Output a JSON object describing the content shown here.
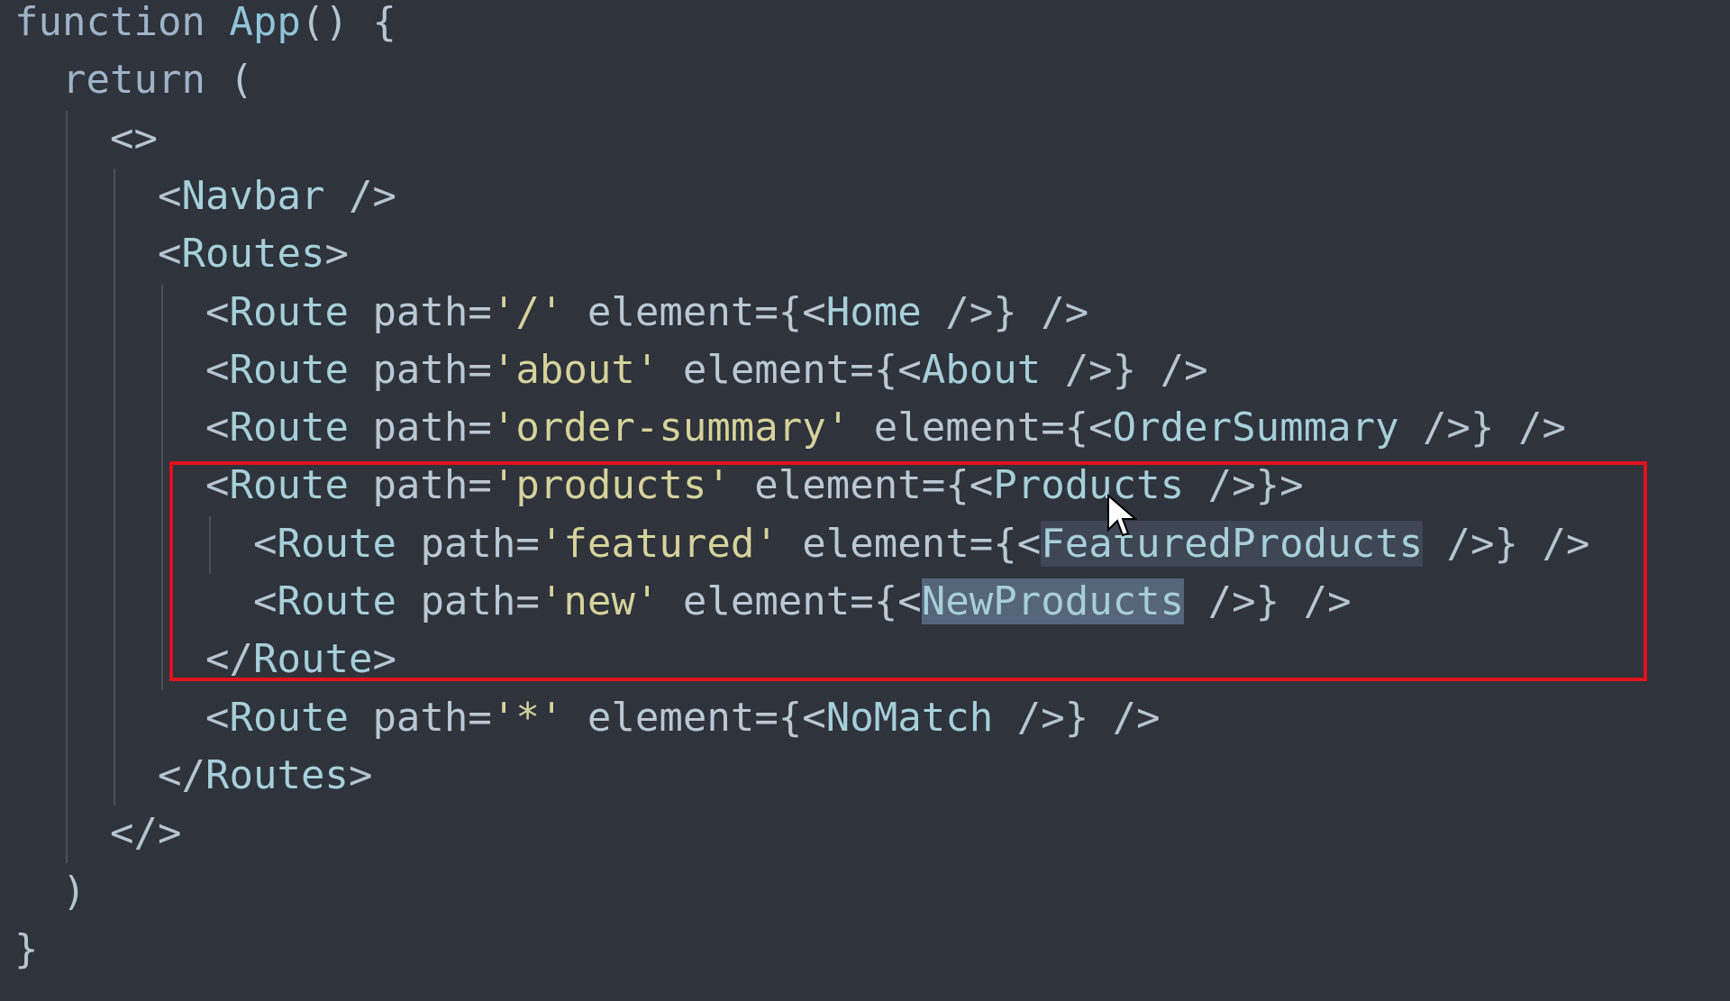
{
  "editor": {
    "theme_colors": {
      "background": "#2e333c",
      "string": "#d6d29a",
      "tag": "#a6cfd9",
      "highlight_box": "#e0121b"
    },
    "lines": [
      {
        "indent": 0,
        "parts": [
          {
            "t": "function",
            "c": "kw"
          },
          {
            "t": " "
          },
          {
            "t": "App",
            "c": "fn"
          },
          {
            "t": "() {",
            "c": "punct"
          }
        ]
      },
      {
        "indent": 1,
        "parts": [
          {
            "t": "return",
            "c": "kw"
          },
          {
            "t": " (",
            "c": "punct"
          }
        ]
      },
      {
        "indent": 2,
        "parts": [
          {
            "t": "<>",
            "c": "punct"
          }
        ]
      },
      {
        "indent": 3,
        "parts": [
          {
            "t": "<",
            "c": "punct"
          },
          {
            "t": "Navbar",
            "c": "tag"
          },
          {
            "t": " />",
            "c": "punct"
          }
        ]
      },
      {
        "indent": 3,
        "parts": [
          {
            "t": "<",
            "c": "punct"
          },
          {
            "t": "Routes",
            "c": "tag"
          },
          {
            "t": ">",
            "c": "punct"
          }
        ]
      },
      {
        "indent": 4,
        "parts": [
          {
            "t": "<",
            "c": "punct"
          },
          {
            "t": "Route",
            "c": "tag"
          },
          {
            "t": " path=",
            "c": "attr"
          },
          {
            "t": "'/'",
            "c": "str"
          },
          {
            "t": " element={<",
            "c": "attr"
          },
          {
            "t": "Home",
            "c": "tag"
          },
          {
            "t": " />} />",
            "c": "punct"
          }
        ]
      },
      {
        "indent": 4,
        "parts": [
          {
            "t": "<",
            "c": "punct"
          },
          {
            "t": "Route",
            "c": "tag"
          },
          {
            "t": " path=",
            "c": "attr"
          },
          {
            "t": "'about'",
            "c": "str"
          },
          {
            "t": " element={<",
            "c": "attr"
          },
          {
            "t": "About",
            "c": "tag"
          },
          {
            "t": " />} />",
            "c": "punct"
          }
        ]
      },
      {
        "indent": 4,
        "parts": [
          {
            "t": "<",
            "c": "punct"
          },
          {
            "t": "Route",
            "c": "tag"
          },
          {
            "t": " path=",
            "c": "attr"
          },
          {
            "t": "'order-summary'",
            "c": "str"
          },
          {
            "t": " element={<",
            "c": "attr"
          },
          {
            "t": "OrderSummary",
            "c": "tag"
          },
          {
            "t": " />} />",
            "c": "punct"
          }
        ]
      },
      {
        "indent": 4,
        "parts": [
          {
            "t": "<",
            "c": "punct"
          },
          {
            "t": "Route",
            "c": "tag"
          },
          {
            "t": " path=",
            "c": "attr"
          },
          {
            "t": "'products'",
            "c": "str"
          },
          {
            "t": " element={<",
            "c": "attr"
          },
          {
            "t": "Products",
            "c": "tag"
          },
          {
            "t": " />}>",
            "c": "punct"
          }
        ]
      },
      {
        "indent": 5,
        "parts": [
          {
            "t": "<",
            "c": "punct"
          },
          {
            "t": "Route",
            "c": "tag"
          },
          {
            "t": " path=",
            "c": "attr"
          },
          {
            "t": "'featured'",
            "c": "str"
          },
          {
            "t": " element={<",
            "c": "attr"
          },
          {
            "t": "FeaturedProducts",
            "c": "tag hl1"
          },
          {
            "t": " />} />",
            "c": "punct"
          }
        ]
      },
      {
        "indent": 5,
        "parts": [
          {
            "t": "<",
            "c": "punct"
          },
          {
            "t": "Route",
            "c": "tag"
          },
          {
            "t": " path=",
            "c": "attr"
          },
          {
            "t": "'new'",
            "c": "str"
          },
          {
            "t": " element={<",
            "c": "attr"
          },
          {
            "t": "NewProducts",
            "c": "tag hl2"
          },
          {
            "t": " />} />",
            "c": "punct"
          }
        ]
      },
      {
        "indent": 4,
        "parts": [
          {
            "t": "</",
            "c": "punct"
          },
          {
            "t": "Route",
            "c": "tag"
          },
          {
            "t": ">",
            "c": "punct"
          }
        ]
      },
      {
        "indent": 4,
        "parts": [
          {
            "t": "<",
            "c": "punct"
          },
          {
            "t": "Route",
            "c": "tag"
          },
          {
            "t": " path=",
            "c": "attr"
          },
          {
            "t": "'*'",
            "c": "str"
          },
          {
            "t": " element={<",
            "c": "attr"
          },
          {
            "t": "NoMatch",
            "c": "tag"
          },
          {
            "t": " />} />",
            "c": "punct"
          }
        ]
      },
      {
        "indent": 3,
        "parts": [
          {
            "t": "</",
            "c": "punct"
          },
          {
            "t": "Routes",
            "c": "tag"
          },
          {
            "t": ">",
            "c": "punct"
          }
        ]
      },
      {
        "indent": 2,
        "parts": [
          {
            "t": "</>",
            "c": "punct"
          }
        ]
      },
      {
        "indent": 1,
        "parts": [
          {
            "t": ")",
            "c": "punct"
          }
        ]
      },
      {
        "indent": 0,
        "parts": [
          {
            "t": "}",
            "c": "punct"
          }
        ]
      }
    ],
    "highlighted_lines": [
      8,
      9,
      10,
      11
    ],
    "selected_text": "NewProducts"
  }
}
